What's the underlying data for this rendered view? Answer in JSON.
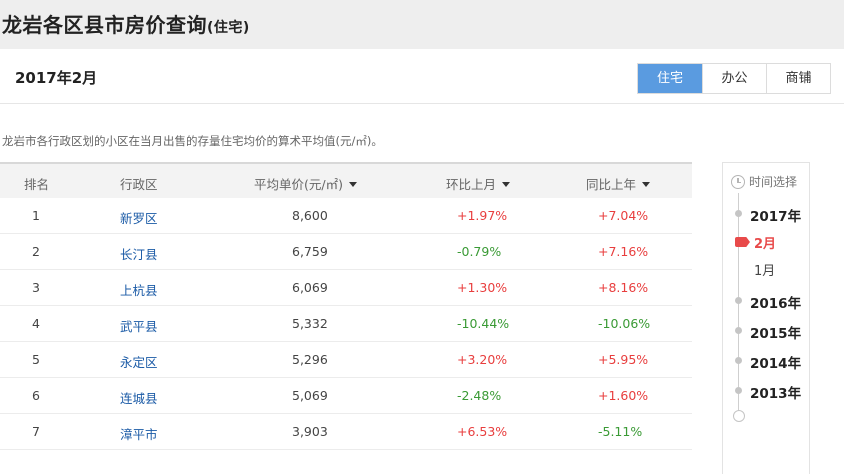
{
  "header": {
    "title": "龙岩各区县市房价查询",
    "subtitle": "(住宅)"
  },
  "period": {
    "title": "2017年2月"
  },
  "type_tabs": [
    {
      "label": "住宅",
      "active": true
    },
    {
      "label": "办公",
      "active": false
    },
    {
      "label": "商铺",
      "active": false
    }
  ],
  "description": "龙岩市各行政区划的小区在当月出售的存量住宅均价的算术平均值(元/㎡)。",
  "table": {
    "headers": {
      "rank": "排名",
      "district": "行政区",
      "price": "平均单价(元/㎡)",
      "mom": "环比上月",
      "yoy": "同比上年"
    },
    "rows": [
      {
        "rank": "1",
        "district": "新罗区",
        "price": "8,600",
        "mom": "+1.97%",
        "yoy": "+7.04%"
      },
      {
        "rank": "2",
        "district": "长汀县",
        "price": "6,759",
        "mom": "-0.79%",
        "yoy": "+7.16%"
      },
      {
        "rank": "3",
        "district": "上杭县",
        "price": "6,069",
        "mom": "+1.30%",
        "yoy": "+8.16%"
      },
      {
        "rank": "4",
        "district": "武平县",
        "price": "5,332",
        "mom": "-10.44%",
        "yoy": "-10.06%"
      },
      {
        "rank": "5",
        "district": "永定区",
        "price": "5,296",
        "mom": "+3.20%",
        "yoy": "+5.95%"
      },
      {
        "rank": "6",
        "district": "连城县",
        "price": "5,069",
        "mom": "-2.48%",
        "yoy": "+1.60%"
      },
      {
        "rank": "7",
        "district": "漳平市",
        "price": "3,903",
        "mom": "+6.53%",
        "yoy": "-5.11%"
      }
    ]
  },
  "timeline": {
    "header": "时间选择",
    "year_2017": "2017年",
    "month_active": "2月",
    "month_other": "1月",
    "year_2016": "2016年",
    "year_2015": "2015年",
    "year_2014": "2014年",
    "year_2013": "2013年"
  },
  "colors": {
    "accent": "#5a9be0",
    "increase": "#e83e3e",
    "decrease": "#3a9a35",
    "link": "#1a5aa6",
    "active_month": "#e84a4a"
  }
}
